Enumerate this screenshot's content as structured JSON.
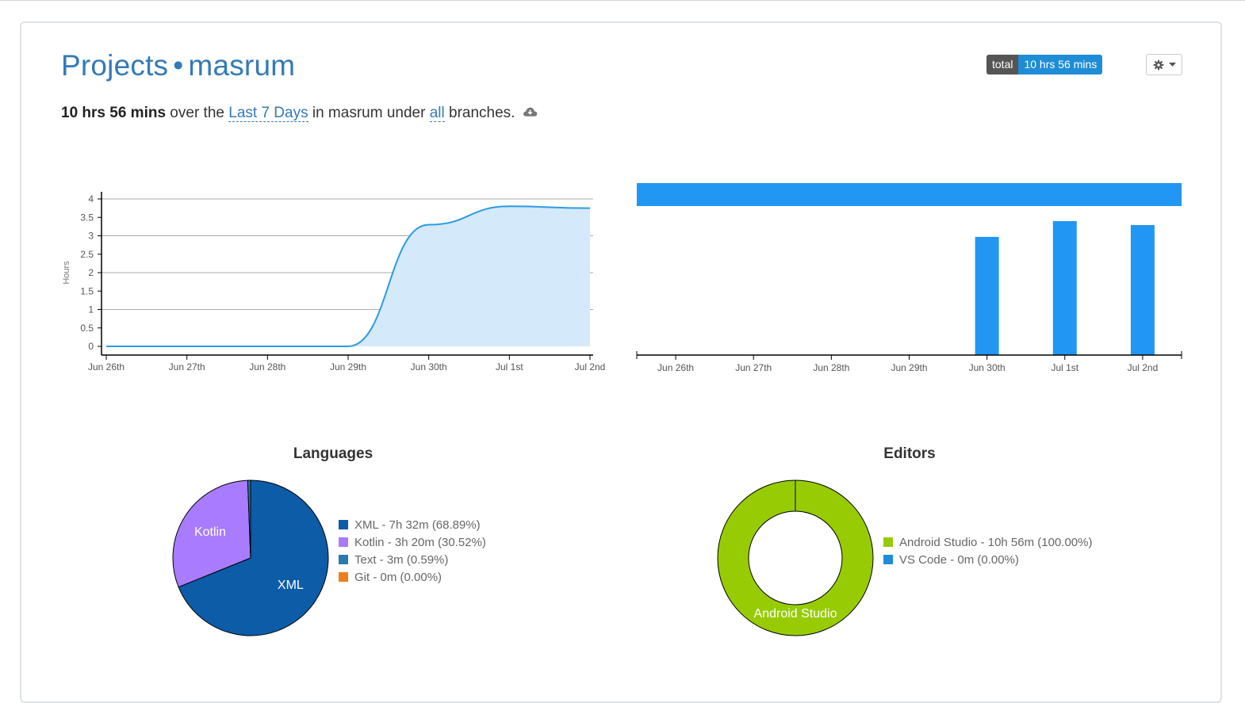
{
  "header": {
    "projects_label": "Projects",
    "separator": "•",
    "project_name": "masrum",
    "badge_key": "total",
    "badge_value": "10 hrs 56 mins",
    "settings_icon": "gear-icon"
  },
  "summary": {
    "total": "10 hrs 56 mins",
    "text1": " over the ",
    "range_link": "Last 7 Days",
    "text2": " in masrum under ",
    "branch_link": "all",
    "text3": " branches.",
    "download_icon": "cloud-download-icon"
  },
  "colors": {
    "link": "#337ab7",
    "accent": "#1f8dd6",
    "bar": "#2196f3",
    "xml": "#0d5ca8",
    "kotlin": "#a97bff",
    "text": "#2a7ab0",
    "git": "#f07d1d",
    "android_studio": "#97cc04",
    "vscode": "#1f8dd6"
  },
  "chart_data": [
    {
      "type": "area",
      "ylabel": "Hours",
      "categories": [
        "Jun 26th",
        "Jun 27th",
        "Jun 28th",
        "Jun 29th",
        "Jun 30th",
        "Jul 1st",
        "Jul 2nd"
      ],
      "values": [
        0.0,
        0.0,
        0.0,
        0.0,
        3.3,
        3.8,
        3.75
      ],
      "yticks": [
        "0",
        "0.5",
        "1",
        "1.5",
        "2",
        "2.5",
        "3",
        "3.5",
        "4"
      ],
      "ylim": [
        0,
        4
      ],
      "grid": true
    },
    {
      "type": "bar",
      "categories": [
        "Jun 26th",
        "Jun 27th",
        "Jun 28th",
        "Jun 29th",
        "Jun 30th",
        "Jul 1st",
        "Jul 2nd"
      ],
      "values": [
        0,
        0,
        0,
        0,
        3.0,
        3.4,
        3.3
      ],
      "ylim": [
        0,
        3.4
      ],
      "total_bar": true
    },
    {
      "type": "pie",
      "title": "Languages",
      "slices": [
        {
          "name": "XML",
          "label": "XML - 7h 32m (68.89%)",
          "percent": 68.89,
          "color": "#0d5ca8"
        },
        {
          "name": "Kotlin",
          "label": "Kotlin - 3h 20m (30.52%)",
          "percent": 30.52,
          "color": "#a97bff"
        },
        {
          "name": "Text",
          "label": "Text - 3m (0.59%)",
          "percent": 0.59,
          "color": "#2a7ab0"
        },
        {
          "name": "Git",
          "label": "Git - 0m (0.00%)",
          "percent": 0.0,
          "color": "#f07d1d"
        }
      ]
    },
    {
      "type": "pie",
      "title": "Editors",
      "donut": true,
      "slices": [
        {
          "name": "Android Studio",
          "label": "Android Studio - 10h 56m (100.00%)",
          "percent": 100.0,
          "color": "#97cc04"
        },
        {
          "name": "VS Code",
          "label": "VS Code - 0m (0.00%)",
          "percent": 0.0,
          "color": "#1f8dd6"
        }
      ]
    }
  ]
}
